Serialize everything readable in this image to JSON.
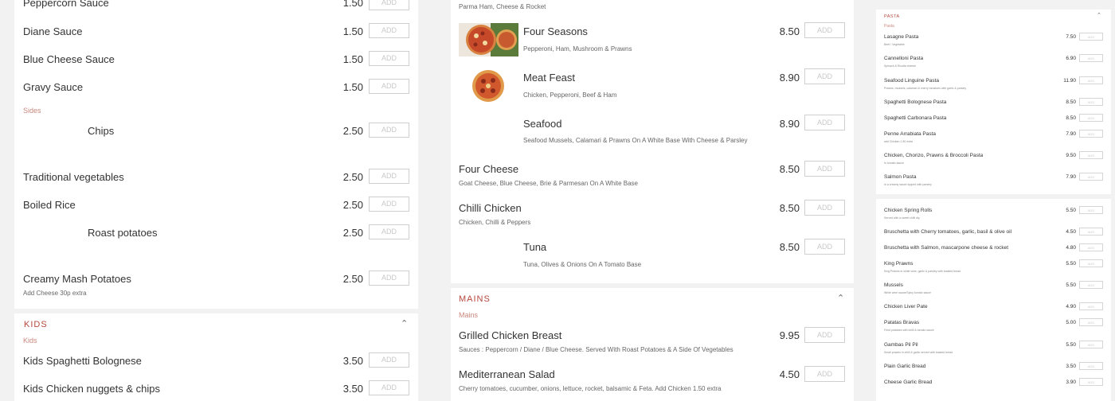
{
  "add_label": "ADD",
  "col1": {
    "items_top": [
      {
        "name": "Peppercorn Sauce",
        "price": "1.50"
      },
      {
        "name": "Diane Sauce",
        "price": "1.50"
      },
      {
        "name": "Blue Cheese Sauce",
        "price": "1.50"
      },
      {
        "name": "Gravy Sauce",
        "price": "1.50"
      }
    ],
    "sides_label": "Sides",
    "sides": [
      {
        "name": "Chips",
        "price": "2.50"
      },
      {
        "name": "Traditional vegetables",
        "price": "2.50"
      },
      {
        "name": "Boiled Rice",
        "price": "2.50"
      },
      {
        "name": "Roast potatoes",
        "price": "2.50"
      },
      {
        "name": "Creamy Mash Potatoes",
        "price": "2.50",
        "desc": "Add Cheese 30p extra"
      }
    ],
    "kids": {
      "title": "KIDS",
      "label": "Kids",
      "items": [
        {
          "name": "Kids Spaghetti Bolognese",
          "price": "3.50"
        },
        {
          "name": "Kids Chicken nuggets & chips",
          "price": "3.50"
        }
      ]
    }
  },
  "col2": {
    "top_desc": "Parma Ham, Cheese & Rocket",
    "pizzas": [
      {
        "name": "Four Seasons",
        "price": "8.50",
        "desc": "Pepperoni, Ham, Mushroom & Prawns"
      },
      {
        "name": "Meat Feast",
        "price": "8.90",
        "desc": "Chicken, Pepperoni, Beef & Ham"
      },
      {
        "name": "Seafood",
        "price": "8.90",
        "desc": "Seafood Mussels, Calamari & Prawns On A White Base With Cheese & Parsley"
      },
      {
        "name": "Four Cheese",
        "price": "8.50",
        "desc": "Goat Cheese, Blue Cheese, Brie & Parmesan On A White Base"
      },
      {
        "name": "Chilli Chicken",
        "price": "8.50",
        "desc": "Chicken, Chilli & Peppers"
      },
      {
        "name": "Tuna",
        "price": "8.50",
        "desc": "Tuna, Olives & Onions On A Tomato Base"
      }
    ],
    "mains": {
      "title": "MAINS",
      "label": "Mains",
      "items": [
        {
          "name": "Grilled Chicken Breast",
          "price": "9.95",
          "desc": "Sauces : Peppercorn / Diane / Blue Cheese. Served With Roast Potatoes & A Side Of Vegetables"
        },
        {
          "name": "Mediterranean Salad",
          "price": "4.50",
          "desc": "Cherry tomatoes, cucumber, onions, lettuce, rocket, balsamic & Feta. Add Chicken 1.50 extra"
        }
      ]
    }
  },
  "col3": {
    "pasta": {
      "title": "PASTA",
      "label": "Pasta",
      "items": [
        {
          "name": "Lasagne Pasta",
          "price": "7.50",
          "desc": "Beef / Vegetable"
        },
        {
          "name": "Cannelloni Pasta",
          "price": "6.90",
          "desc": "Spinach & Ricotta cheese"
        },
        {
          "name": "Seafood Linguine Pasta",
          "price": "11.90",
          "desc": "Prawns, mussels, calamari & cherry tomatoes with garlic & parsley"
        },
        {
          "name": "Spaghetti Bolognese Pasta",
          "price": "8.50",
          "desc": ""
        },
        {
          "name": "Spaghetti Carbonara Pasta",
          "price": "8.50",
          "desc": ""
        },
        {
          "name": "Penne Arrabiata Pasta",
          "price": "7.90",
          "desc": "add Chicken 1.50 extra"
        },
        {
          "name": "Chicken, Chorizo, Prawns & Broccoli Pasta",
          "price": "9.50",
          "desc": "In tomato sauce"
        },
        {
          "name": "Salmon Pasta",
          "price": "7.90",
          "desc": "In a creamy sauce topped with parsley"
        }
      ]
    },
    "starters": [
      {
        "name": "Chicken Spring Rolls",
        "price": "5.50",
        "desc": "Served with a sweet chilli dip"
      },
      {
        "name": "Bruschetta with Cherry tomatoes, garlic, basil & olive oil",
        "price": "4.50",
        "desc": ""
      },
      {
        "name": "Bruschetta with Salmon, mascarpone cheese & rocket",
        "price": "4.80",
        "desc": ""
      },
      {
        "name": "King Prawns",
        "price": "5.50",
        "desc": "King Prawns in white wine, garlic & parsley with toasted bread"
      },
      {
        "name": "Mussels",
        "price": "5.50",
        "desc": "White wine sauce/Spicy tomato sauce"
      },
      {
        "name": "Chicken Liver Pate",
        "price": "4.90",
        "desc": ""
      },
      {
        "name": "Patatas Bravas",
        "price": "5.00",
        "desc": "Fried potatoes with chilli & tomato sauce"
      },
      {
        "name": "Gambas Pil Pil",
        "price": "5.50",
        "desc": "Small prawns in chilli & garlic served with toasted bread"
      },
      {
        "name": "Plain Garlic Bread",
        "price": "3.50",
        "desc": ""
      },
      {
        "name": "Cheese Garlic Bread",
        "price": "3.90",
        "desc": ""
      }
    ]
  },
  "colors": {
    "accent": "#b5483d",
    "category": "#c9887d"
  }
}
